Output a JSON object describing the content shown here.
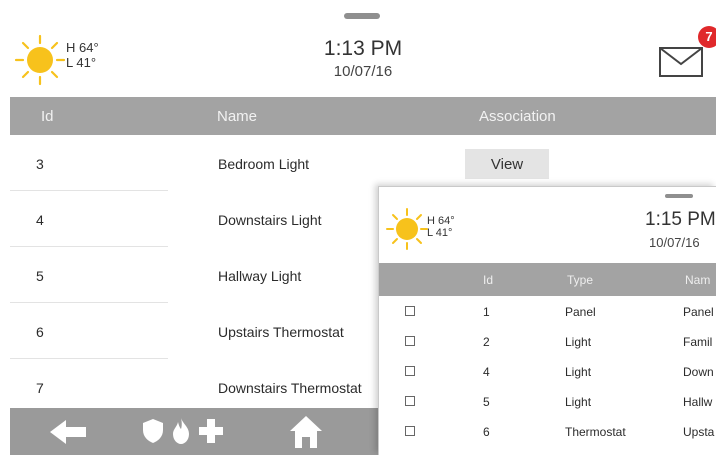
{
  "header": {
    "weather": {
      "icon": "sun-icon",
      "high": "H 64°",
      "low": "L 41°"
    },
    "time": "1:13 PM",
    "date": "10/07/16",
    "messages": {
      "icon": "envelope-icon",
      "count": "7"
    }
  },
  "table": {
    "columns": [
      "Id",
      "Name",
      "Association"
    ],
    "rows": [
      {
        "id": "3",
        "name": "Bedroom Light",
        "action": "View"
      },
      {
        "id": "4",
        "name": "Downstairs Light"
      },
      {
        "id": "5",
        "name": "Hallway Light"
      },
      {
        "id": "6",
        "name": "Upstairs Thermostat"
      },
      {
        "id": "7",
        "name": "Downstairs Thermostat"
      }
    ]
  },
  "bottom_bar": {
    "icons": [
      "back-arrow-icon",
      "shield-icon",
      "fire-icon",
      "medical-cross-icon",
      "home-icon"
    ]
  },
  "overlay": {
    "weather": {
      "high": "H 64°",
      "low": "L 41°"
    },
    "time": "1:15 PM",
    "date": "10/07/16",
    "columns": [
      "Id",
      "Type",
      "Nam"
    ],
    "rows": [
      {
        "id": "1",
        "type": "Panel",
        "name": "Panel"
      },
      {
        "id": "2",
        "type": "Light",
        "name": "Famil"
      },
      {
        "id": "4",
        "type": "Light",
        "name": "Down"
      },
      {
        "id": "5",
        "type": "Light",
        "name": "Hallw"
      },
      {
        "id": "6",
        "type": "Thermostat",
        "name": "Upsta"
      }
    ]
  },
  "colors": {
    "header_bar": "#a3a3a3",
    "bottom_bar": "#9a9a9a",
    "badge": "#e0292b",
    "sun": "#f7c21c"
  }
}
